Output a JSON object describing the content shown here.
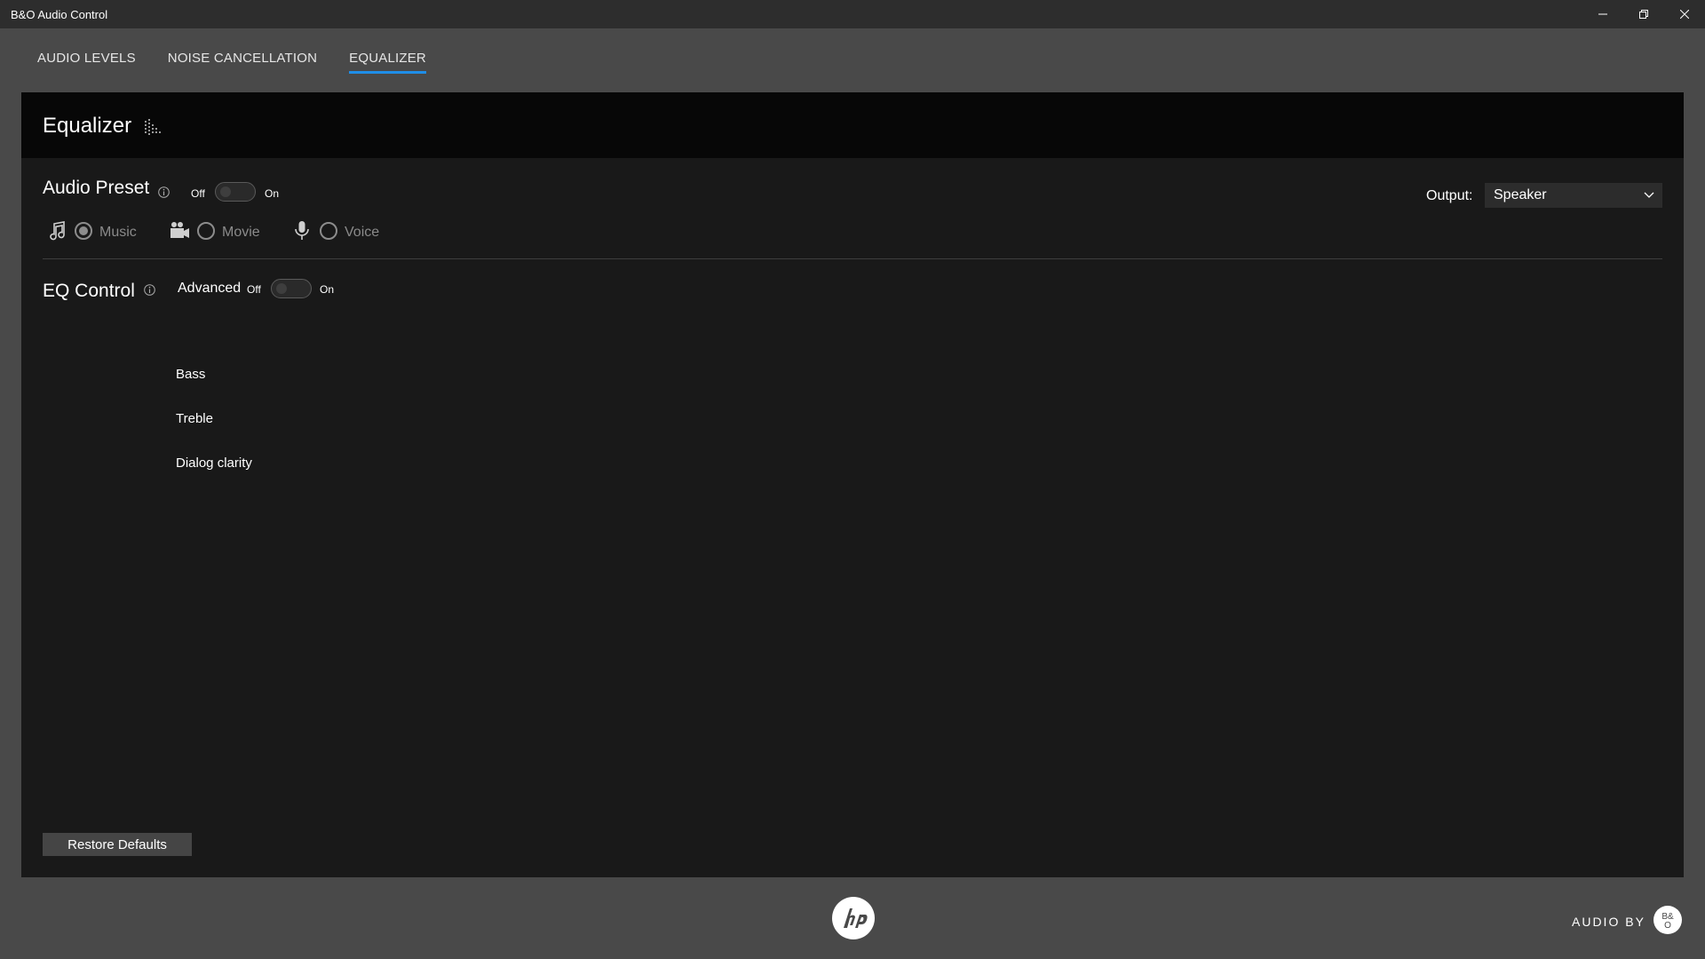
{
  "window": {
    "title": "B&O Audio Control",
    "controls": {
      "minimize_icon": "minimize-icon",
      "restore_icon": "restore-icon",
      "close_icon": "close-icon"
    }
  },
  "tabs": [
    {
      "label": "AUDIO LEVELS",
      "active": false
    },
    {
      "label": "NOISE CANCELLATION",
      "active": false
    },
    {
      "label": "EQUALIZER",
      "active": true
    }
  ],
  "panel": {
    "title": "Equalizer",
    "title_icon": "equalizer-icon"
  },
  "audio_preset": {
    "title": "Audio Preset",
    "toggle": {
      "off_label": "Off",
      "on_label": "On",
      "state": "off"
    },
    "options": [
      {
        "label": "Music",
        "icon": "music-note-icon",
        "selected": true
      },
      {
        "label": "Movie",
        "icon": "movie-camera-icon",
        "selected": false
      },
      {
        "label": "Voice",
        "icon": "microphone-icon",
        "selected": false
      }
    ]
  },
  "output": {
    "label": "Output:",
    "selected": "Speaker"
  },
  "eq_control": {
    "title": "EQ Control",
    "advanced_label": "Advanced",
    "toggle": {
      "off_label": "Off",
      "on_label": "On",
      "state": "off"
    },
    "sliders": [
      {
        "label": "Bass"
      },
      {
        "label": "Treble"
      },
      {
        "label": "Dialog clarity"
      }
    ]
  },
  "footer": {
    "restore_label": "Restore Defaults",
    "audio_by": "AUDIO BY"
  },
  "colors": {
    "accent": "#1f8ee8",
    "background": "#494949",
    "panel": "#191919",
    "panel_header": "#070707"
  }
}
